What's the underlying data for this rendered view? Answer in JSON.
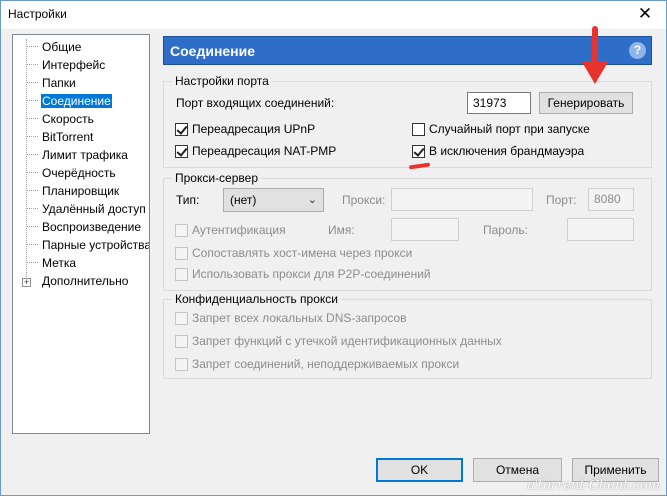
{
  "window": {
    "title": "Настройки",
    "close_glyph": "✕"
  },
  "tree": {
    "items": [
      {
        "label": "Общие",
        "selected": false
      },
      {
        "label": "Интерфейс",
        "selected": false
      },
      {
        "label": "Папки",
        "selected": false
      },
      {
        "label": "Соединение",
        "selected": true
      },
      {
        "label": "Скорость",
        "selected": false
      },
      {
        "label": "BitTorrent",
        "selected": false
      },
      {
        "label": "Лимит трафика",
        "selected": false
      },
      {
        "label": "Очерёдность",
        "selected": false
      },
      {
        "label": "Планировщик",
        "selected": false
      },
      {
        "label": "Удалённый доступ",
        "selected": false
      },
      {
        "label": "Воспроизведение",
        "selected": false
      },
      {
        "label": "Парные устройства",
        "selected": false
      },
      {
        "label": "Метка",
        "selected": false
      },
      {
        "label": "Дополнительно",
        "selected": false,
        "expandable": true
      }
    ],
    "expand_glyph": "+"
  },
  "header": {
    "title": "Соединение",
    "help_glyph": "?"
  },
  "port_settings": {
    "title": "Настройки порта",
    "incoming_label": "Порт входящих соединений:",
    "port_value": "31973",
    "generate_label": "Генерировать",
    "upnp_label": "Переадресация UPnP",
    "upnp_checked": true,
    "natpmp_label": "Переадресация NAT-PMP",
    "natpmp_checked": true,
    "random_port_label": "Случайный порт при запуске",
    "random_port_checked": false,
    "firewall_label": "В исключения брандмауэра",
    "firewall_checked": true
  },
  "proxy": {
    "title": "Прокси-сервер",
    "type_label": "Тип:",
    "type_value": "(нет)",
    "proxy_label": "Прокси:",
    "proxy_value": "",
    "port_label": "Порт:",
    "port_value": "8080",
    "auth_label": "Аутентификация",
    "username_label": "Имя:",
    "password_label": "Пароль:",
    "resolve_label": "Сопоставлять хост-имена через прокси",
    "p2p_label": "Использовать прокси для P2P-соединений"
  },
  "privacy": {
    "title": "Конфиденциальность прокси",
    "dns_label": "Запрет всех локальных DNS-запросов",
    "leak_label": "Запрет функций с утечкой идентификационных данных",
    "unsupported_label": "Запрет соединений, неподдерживаемых прокси"
  },
  "footer": {
    "ok_label": "OK",
    "cancel_label": "Отмена",
    "apply_label": "Применить"
  },
  "watermark": "uTorrent-Client.com",
  "colors": {
    "header_bg": "#2e6ec9",
    "selection": "#0078d7",
    "annotation": "#e8322d"
  }
}
